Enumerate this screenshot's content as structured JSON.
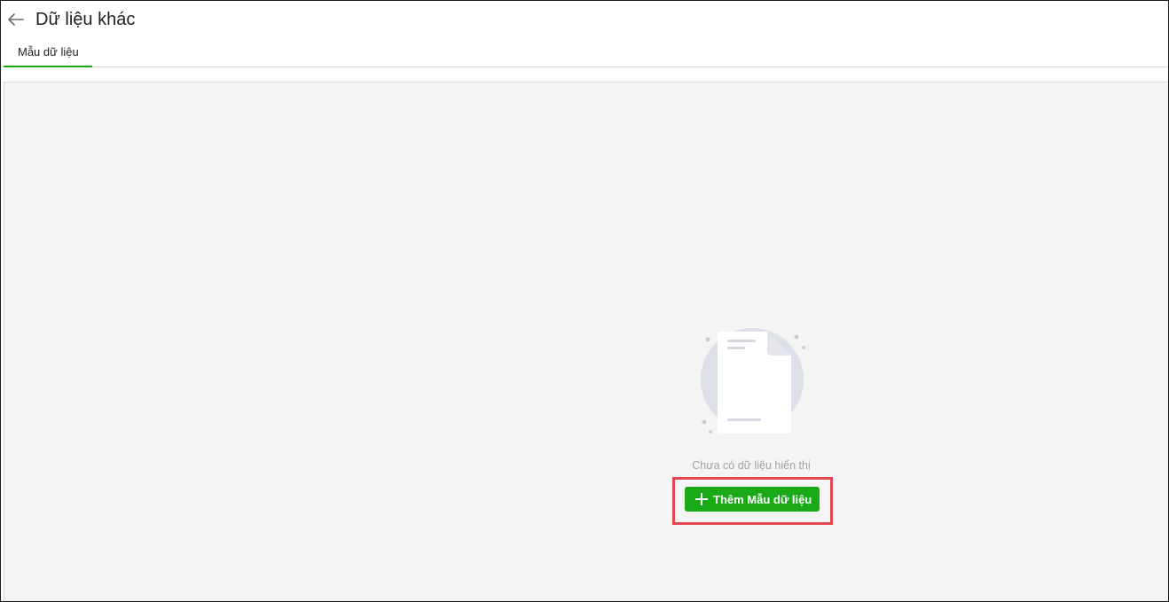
{
  "header": {
    "title": "Dữ liệu khác",
    "back_icon": "arrow-left-icon"
  },
  "tabs": [
    {
      "label": "Mẫu dữ liệu",
      "active": true
    }
  ],
  "empty_state": {
    "illustration_icon": "empty-document-icon",
    "message": "Chưa có dữ liệu hiển thị",
    "add_button_label": "Thêm Mẫu dữ liệu",
    "add_button_icon": "plus-icon"
  },
  "colors": {
    "accent": "#1aaa18",
    "highlight": "#e5454f",
    "content_bg": "#f4f4f4"
  }
}
